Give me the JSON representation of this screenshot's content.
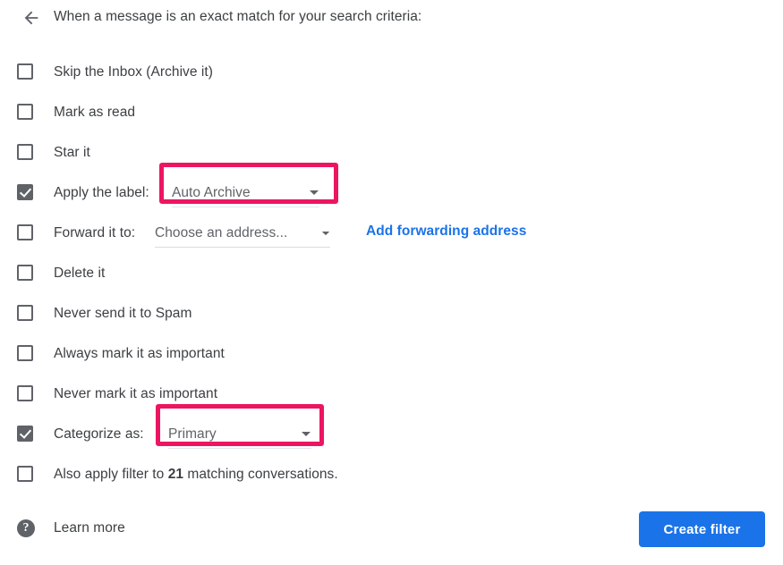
{
  "header": {
    "back_icon": "back-arrow-icon",
    "title": "When a message is an exact match for your search criteria:"
  },
  "rows": [
    {
      "label": "Skip the Inbox (Archive it)",
      "checked": false
    },
    {
      "label": "Mark as read",
      "checked": false
    },
    {
      "label": "Star it",
      "checked": false
    },
    {
      "label": "Apply the label:",
      "checked": true
    },
    {
      "label": "Forward it to:",
      "checked": false
    },
    {
      "label": "Delete it",
      "checked": false
    },
    {
      "label": "Never send it to Spam",
      "checked": false
    },
    {
      "label": "Always mark it as important",
      "checked": false
    },
    {
      "label": "Never mark it as important",
      "checked": false
    },
    {
      "label": "Categorize as:",
      "checked": true
    }
  ],
  "also_apply": {
    "prefix": "Also apply filter to",
    "count": "21",
    "suffix": "matching conversations.",
    "checked": false
  },
  "dropdowns": {
    "label_select": {
      "value": "Auto Archive",
      "caret": "chevron-down-icon"
    },
    "forward_select": {
      "value": "Choose an address...",
      "caret": "chevron-down-icon"
    },
    "category_select": {
      "value": "Primary",
      "caret": "chevron-down-icon"
    }
  },
  "links": {
    "add_forwarding_address": "Add forwarding address"
  },
  "footer": {
    "help_icon": "help-question-icon",
    "learn_more": "Learn more",
    "create_filter": "Create filter"
  },
  "colors": {
    "highlight_pink": "#ec1561",
    "accent_blue": "#1a73e8",
    "text_primary": "#3c4043",
    "text_secondary": "#5f6368"
  }
}
